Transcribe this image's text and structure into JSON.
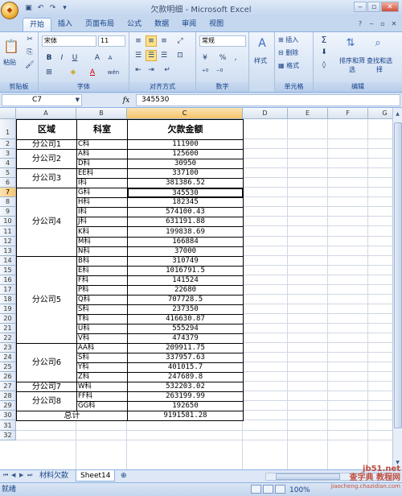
{
  "window": {
    "title": "欠款明细 - Microsoft Excel",
    "office_button": "Office",
    "qat_icons": [
      "save-icon",
      "undo-icon",
      "redo-icon",
      "qat-dropdown-icon"
    ]
  },
  "ribbon_tabs": [
    "开始",
    "插入",
    "页面布局",
    "公式",
    "数据",
    "审阅",
    "视图"
  ],
  "ribbon": {
    "clipboard": {
      "paste_label": "粘贴",
      "group_label": "剪贴板"
    },
    "font": {
      "font_name": "宋体",
      "font_size": "11",
      "bold": "B",
      "italic": "I",
      "underline": "U",
      "grow": "A",
      "shrink": "A",
      "group_label": "字体",
      "font_color": "A",
      "phonetic": "wén"
    },
    "alignment": {
      "group_label": "对齐方式"
    },
    "number": {
      "format": "常规",
      "percent": "%",
      "comma": ",",
      "group_label": "数字"
    },
    "styles": {
      "label": "样式"
    },
    "cells": {
      "insert": "插入",
      "delete": "删除",
      "format": "格式",
      "group_label": "单元格"
    },
    "editing": {
      "sigma": "Σ",
      "sort_filter": "排序和筛选",
      "find_select": "查找和选择",
      "group_label": "编辑"
    }
  },
  "formula_bar": {
    "name_box": "C7",
    "fx": "fx",
    "content": "345530"
  },
  "columns": [
    "A",
    "B",
    "C",
    "D",
    "E",
    "F",
    "G"
  ],
  "rows": [
    "1",
    "2",
    "3",
    "4",
    "5",
    "6",
    "7",
    "8",
    "9",
    "10",
    "11",
    "12",
    "13",
    "14",
    "15",
    "16",
    "17",
    "18",
    "19",
    "20",
    "21",
    "22",
    "23",
    "24",
    "25",
    "26",
    "27",
    "28",
    "29",
    "30",
    "31",
    "32"
  ],
  "sheet": {
    "header": {
      "a": "区域",
      "b": "科室",
      "c": "欠款金额"
    },
    "groups": [
      {
        "region": "分公司1",
        "rows": [
          2,
          2
        ]
      },
      {
        "region": "分公司2",
        "rows": [
          3,
          4
        ]
      },
      {
        "region": "分公司3",
        "rows": [
          5,
          6
        ]
      },
      {
        "region": "分公司4",
        "rows": [
          7,
          13
        ]
      },
      {
        "region": "分公司5",
        "rows": [
          14,
          22
        ]
      },
      {
        "region": "分公司6",
        "rows": [
          23,
          26
        ]
      },
      {
        "region": "分公司7",
        "rows": [
          27,
          27
        ]
      },
      {
        "region": "分公司8",
        "rows": [
          28,
          29
        ]
      }
    ],
    "data": [
      {
        "dept": "C科",
        "amount": "111900"
      },
      {
        "dept": "A科",
        "amount": "125600"
      },
      {
        "dept": "D科",
        "amount": "30950"
      },
      {
        "dept": "EE科",
        "amount": "337100"
      },
      {
        "dept": "I科",
        "amount": "381386.52"
      },
      {
        "dept": "G科",
        "amount": "345530"
      },
      {
        "dept": "H科",
        "amount": "182345"
      },
      {
        "dept": "I科",
        "amount": "574100.43"
      },
      {
        "dept": "J科",
        "amount": "631191.88"
      },
      {
        "dept": "K科",
        "amount": "199838.69"
      },
      {
        "dept": "M科",
        "amount": "166884"
      },
      {
        "dept": "N科",
        "amount": "37000"
      },
      {
        "dept": "B科",
        "amount": "310749"
      },
      {
        "dept": "E科",
        "amount": "1016791.5"
      },
      {
        "dept": "F科",
        "amount": "141524"
      },
      {
        "dept": "P科",
        "amount": "22680"
      },
      {
        "dept": "Q科",
        "amount": "707728.5"
      },
      {
        "dept": "S科",
        "amount": "237350"
      },
      {
        "dept": "T科",
        "amount": "416630.87"
      },
      {
        "dept": "U科",
        "amount": "555294"
      },
      {
        "dept": "V科",
        "amount": "474379"
      },
      {
        "dept": "AA科",
        "amount": "209911.75"
      },
      {
        "dept": "S科",
        "amount": "337957.63"
      },
      {
        "dept": "Y科",
        "amount": "401015.7"
      },
      {
        "dept": "Z科",
        "amount": "247689.8"
      },
      {
        "dept": "W科",
        "amount": "532203.02"
      },
      {
        "dept": "FF科",
        "amount": "263199.99"
      },
      {
        "dept": "GG科",
        "amount": "192650"
      }
    ],
    "total": {
      "label": "总计",
      "amount": "9191581.28"
    },
    "selected_cell": "C7"
  },
  "sheet_tabs": [
    "材料欠款",
    "Sheet14"
  ],
  "status": {
    "ready": "就绪",
    "zoom": "100%"
  },
  "watermark": {
    "line1": "jb51.net",
    "line2": "查字典 教程网",
    "line3": "jiaocheng.chazidian.com"
  }
}
